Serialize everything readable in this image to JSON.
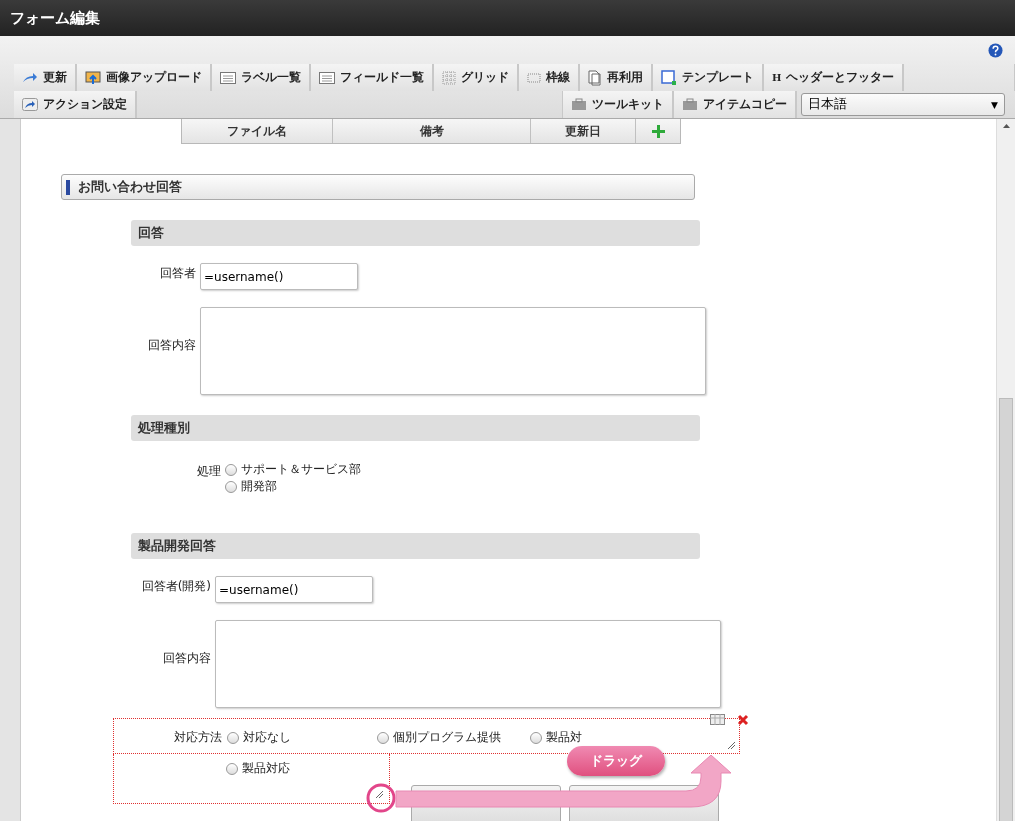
{
  "window": {
    "title": "フォーム編集"
  },
  "toolbar": {
    "row1": [
      {
        "label": "更新"
      },
      {
        "label": "画像アップロード"
      },
      {
        "label": "ラベル一覧"
      },
      {
        "label": "フィールド一覧"
      },
      {
        "label": "グリッド"
      },
      {
        "label": "枠線"
      },
      {
        "label": "再利用"
      },
      {
        "label": "テンプレート"
      },
      {
        "label": "ヘッダーとフッター",
        "glyph": "H"
      }
    ],
    "row2_left": [
      {
        "label": "アクション設定"
      }
    ],
    "row2_right": [
      {
        "label": "ツールキット"
      },
      {
        "label": "アイテムコピー"
      }
    ],
    "language": {
      "value": "日本語",
      "caret": "▼"
    }
  },
  "file_table": {
    "columns": [
      "ファイル名",
      "備考",
      "更新日"
    ]
  },
  "section": {
    "title": "お問い合わせ回答",
    "subsections": [
      {
        "title": "回答",
        "fields": [
          {
            "kind": "text",
            "label": "回答者",
            "value": "=username()"
          },
          {
            "kind": "textarea",
            "label": "回答内容"
          }
        ]
      },
      {
        "title": "処理種別",
        "fields": [
          {
            "kind": "radio",
            "label": "処理",
            "options": [
              {
                "label": "サポート＆サービス部",
                "selected": false
              },
              {
                "label": "開発部",
                "selected": false
              }
            ]
          }
        ]
      },
      {
        "title": "製品開発回答",
        "fields": [
          {
            "kind": "text",
            "label": "回答者(開発)",
            "value": "=username()"
          },
          {
            "kind": "textarea",
            "label": "回答内容"
          }
        ]
      }
    ]
  },
  "edit_block": {
    "label": "対応方法",
    "options": [
      {
        "label": "対応なし",
        "selected": false
      },
      {
        "label": "個別プログラム提供",
        "selected": false
      },
      {
        "label": "製品対",
        "selected": false
      }
    ],
    "second_row": [
      {
        "label": "製品対応",
        "selected": false
      }
    ]
  },
  "drag_hint": {
    "label": "ドラッグ"
  }
}
